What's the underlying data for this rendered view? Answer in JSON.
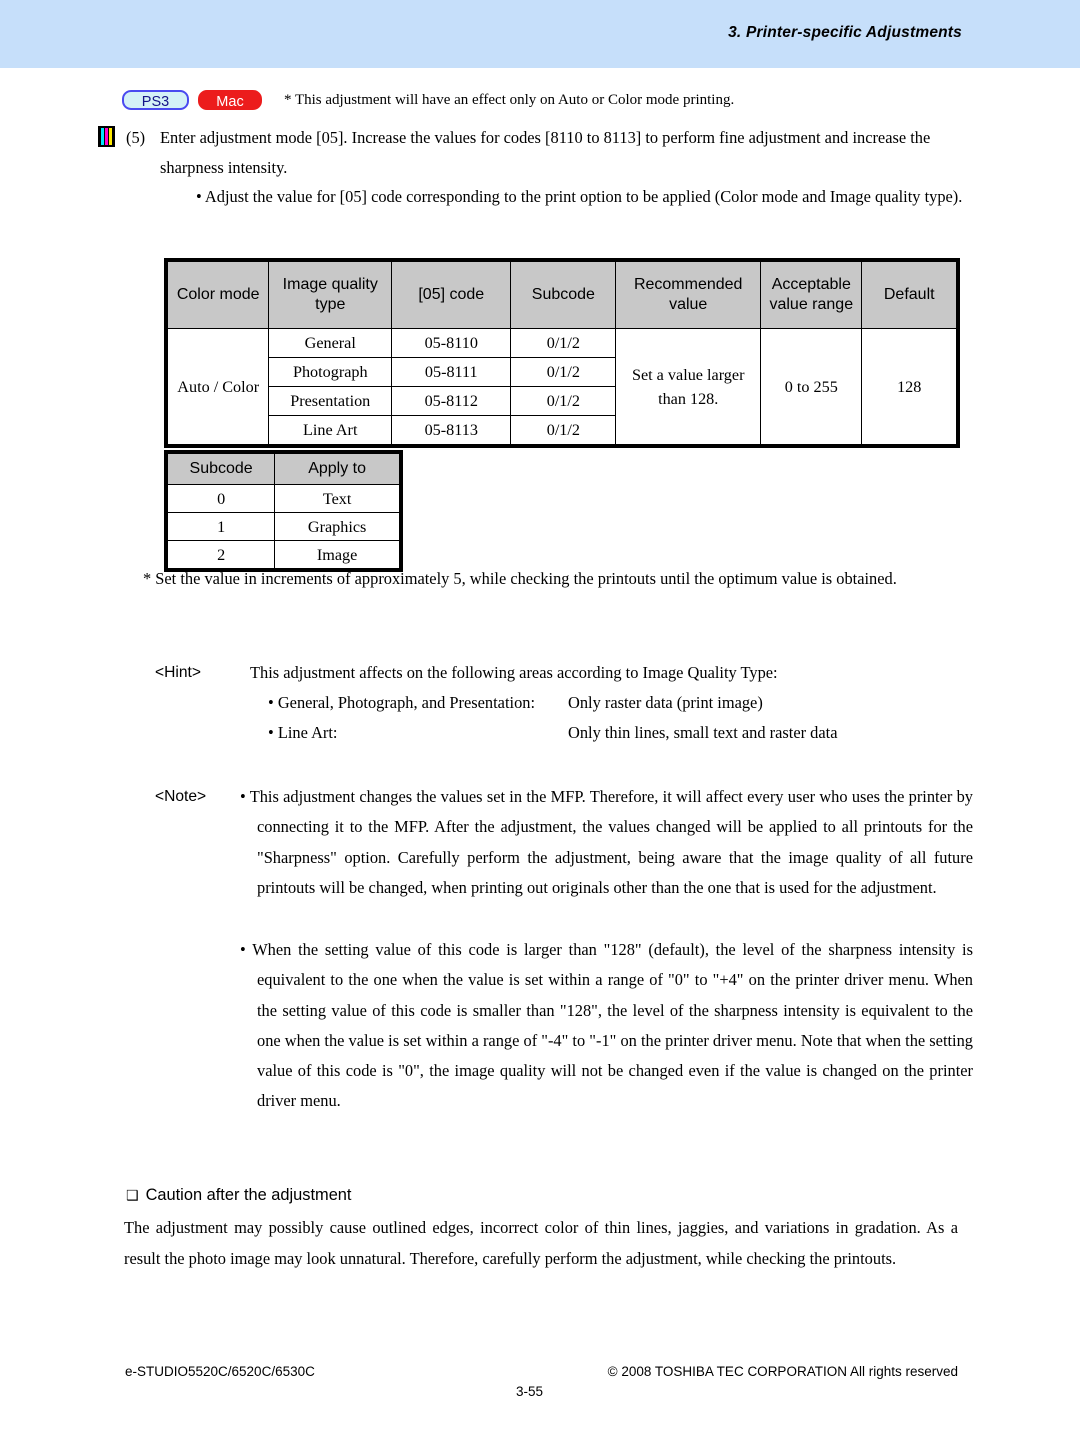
{
  "header": {
    "title": "3. Printer-specific Adjustments",
    "band_color": "#c6dffa"
  },
  "badges": {
    "ps3": "PS3",
    "mac": "Mac",
    "note": "* This adjustment will have an effect only on Auto or Color mode printing."
  },
  "step": {
    "marker_icon": "cmyk-bar-icon",
    "number": "(5)",
    "text": "Enter adjustment mode [05].  Increase the values for codes [8110 to 8113] to perform fine adjustment and increase the sharpness intensity.",
    "bullet": "• Adjust the value for [05] code corresponding to the print option to be applied (Color mode and Image quality type)."
  },
  "main_table": {
    "headers": [
      "Color mode",
      "Image quality type",
      "[05] code",
      "Subcode",
      "Recommended value",
      "Acceptable value range",
      "Default"
    ],
    "color_mode": "Auto / Color",
    "recommended_value": "Set a value larger than 128.",
    "acceptable_range": "0 to 255",
    "default": "128",
    "rows": [
      {
        "image_quality_type": "General",
        "code": "05-8110",
        "subcode": "0/1/2"
      },
      {
        "image_quality_type": "Photograph",
        "code": "05-8111",
        "subcode": "0/1/2"
      },
      {
        "image_quality_type": "Presentation",
        "code": "05-8112",
        "subcode": "0/1/2"
      },
      {
        "image_quality_type": "Line Art",
        "code": "05-8113",
        "subcode": "0/1/2"
      }
    ]
  },
  "subcode_table": {
    "headers": [
      "Subcode",
      "Apply to"
    ],
    "rows": [
      {
        "subcode": "0",
        "apply_to": "Text"
      },
      {
        "subcode": "1",
        "apply_to": "Graphics"
      },
      {
        "subcode": "2",
        "apply_to": "Image"
      }
    ]
  },
  "star_note": "* Set the value in increments of approximately 5, while checking the printouts until the optimum value is obtained.",
  "hint": {
    "label": "<Hint>",
    "lead": "This adjustment affects on the following areas according to Image Quality Type:",
    "rows": [
      {
        "subject": "• General, Photograph, and Presentation:",
        "value": "Only raster data (print image)"
      },
      {
        "subject": "• Line Art:",
        "value": "Only thin lines, small text and raster data"
      }
    ]
  },
  "note": {
    "label": "<Note>",
    "items": [
      "• This adjustment changes the values set in the MFP.  Therefore, it will affect every user who uses the printer by connecting it to the MFP.  After the adjustment, the values changed will be applied to all printouts for the \"Sharpness\" option.  Carefully perform the adjustment, being aware that the image quality of all future printouts will be changed, when printing out originals other than the one that is used for the adjustment.",
      "• When the setting value of this code is larger than \"128\" (default), the level of the sharpness intensity is equivalent to the one when the value is set within a range of \"0\" to \"+4\" on the printer driver menu. When the setting value of this code is smaller than \"128\", the level of the sharpness intensity is equivalent to the one when the value is set within a range of \"-4\" to \"-1\" on the printer driver menu. Note that when the setting value of this code is \"0\", the image quality will not be changed even if the value is changed on the printer driver menu."
    ]
  },
  "caution": {
    "box_glyph": "❑",
    "heading": "Caution after the adjustment",
    "body": "The adjustment may possibly cause outlined edges, incorrect color of thin lines, jaggies, and variations in gradation.  As a result the photo image may look unnatural.  Therefore, carefully perform the adjustment, while checking the printouts."
  },
  "footer": {
    "model": "e-STUDIO5520C/6520C/6530C",
    "copyright": "© 2008 TOSHIBA TEC CORPORATION All rights reserved",
    "page": "3-55"
  }
}
